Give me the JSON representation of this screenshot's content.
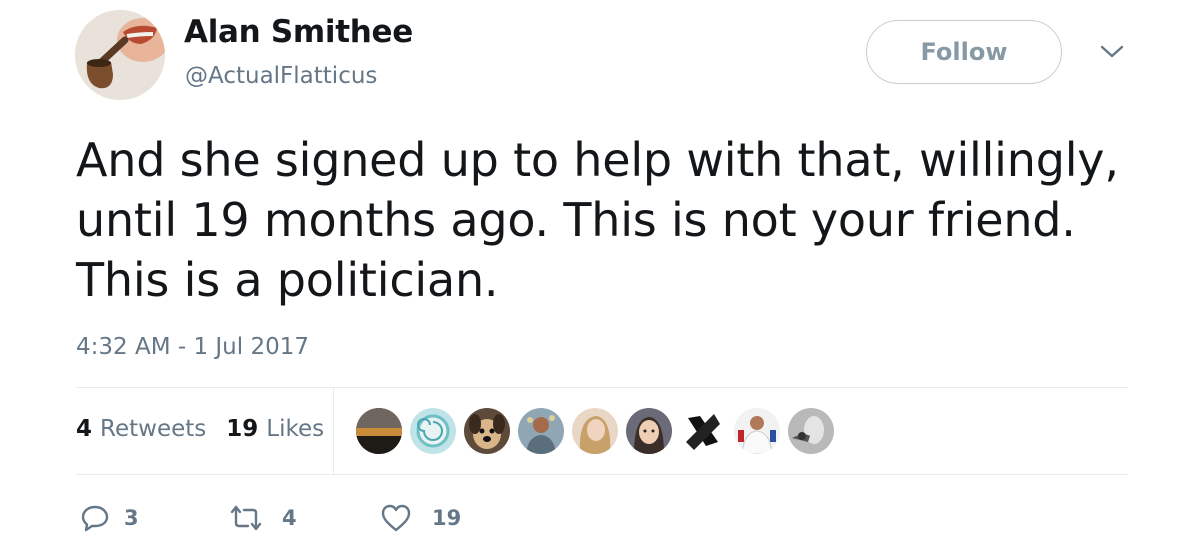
{
  "author": {
    "display_name": "Alan Smithee",
    "handle": "@ActualFlatticus",
    "avatar_icon": "avatar-pipe-smoker"
  },
  "follow_button": {
    "label": "Follow"
  },
  "menu_caret_icon": "chevron-down-icon",
  "tweet": {
    "text": "And she signed up to help with that, willingly,\nuntil 19 months ago.  This is not your friend.\nThis is a politician.",
    "timestamp": "4:32 AM - 1 Jul 2017"
  },
  "stats": {
    "retweets_count": "4",
    "retweets_label": "Retweets",
    "likes_count": "19",
    "likes_label": "Likes"
  },
  "likers": [
    {
      "name": "liker-avatar-sunset"
    },
    {
      "name": "liker-avatar-shell"
    },
    {
      "name": "liker-avatar-dog"
    },
    {
      "name": "liker-avatar-figure"
    },
    {
      "name": "liker-avatar-woman"
    },
    {
      "name": "liker-avatar-girl"
    },
    {
      "name": "liker-avatar-x-logo"
    },
    {
      "name": "liker-avatar-man"
    },
    {
      "name": "liker-avatar-bird"
    }
  ],
  "actions": {
    "reply_count": "3",
    "retweet_count": "4",
    "like_count": "19"
  },
  "colors": {
    "text_primary": "#14171a",
    "text_secondary": "#657786",
    "border": "#e6ecf0"
  }
}
